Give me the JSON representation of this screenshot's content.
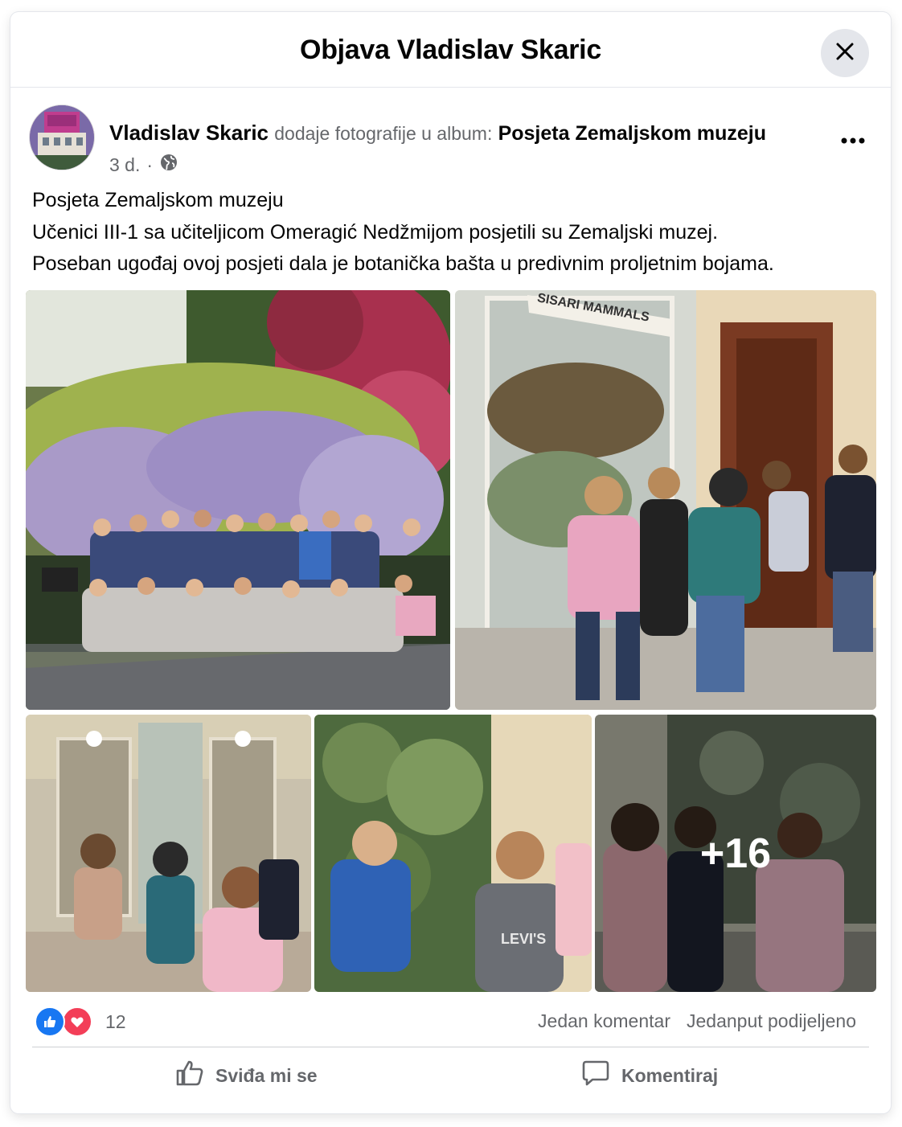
{
  "modal": {
    "title": "Objava Vladislav Skaric",
    "close_icon": "close-icon"
  },
  "post": {
    "author": "Vladislav Skaric",
    "action": "dodaje fotografije u album:",
    "album": "Posjeta Zemaljskom muzeju",
    "time": "3 d.",
    "separator": "·",
    "privacy_icon": "globe-icon",
    "more_icon": "more-dots-icon",
    "text_lines": [
      "Posjeta Zemaljskom muzeju",
      "Učenici III-1 sa učiteljicom Omeragić Nedžmijom posjetili su Zemaljski muzej.",
      "Poseban ugođaj ovoj posjeti dala je botanička bašta u predivnim proljetnim bojama."
    ]
  },
  "photos": {
    "more_count": "+16",
    "mammals_sign": "SISARI MAMMALS",
    "shirt_text": "LEVI'S"
  },
  "engagement": {
    "reaction_icons": [
      "like-icon",
      "love-icon"
    ],
    "reaction_count": "12",
    "comments": "Jedan komentar",
    "shares": "Jedanput podijeljeno"
  },
  "actions": {
    "like_label": "Sviđa mi se",
    "comment_label": "Komentiraj"
  },
  "colors": {
    "brand_blue": "#1877f2",
    "love_red": "#f33e58",
    "secondary_text": "#65676b",
    "divider": "#ced0d4"
  }
}
